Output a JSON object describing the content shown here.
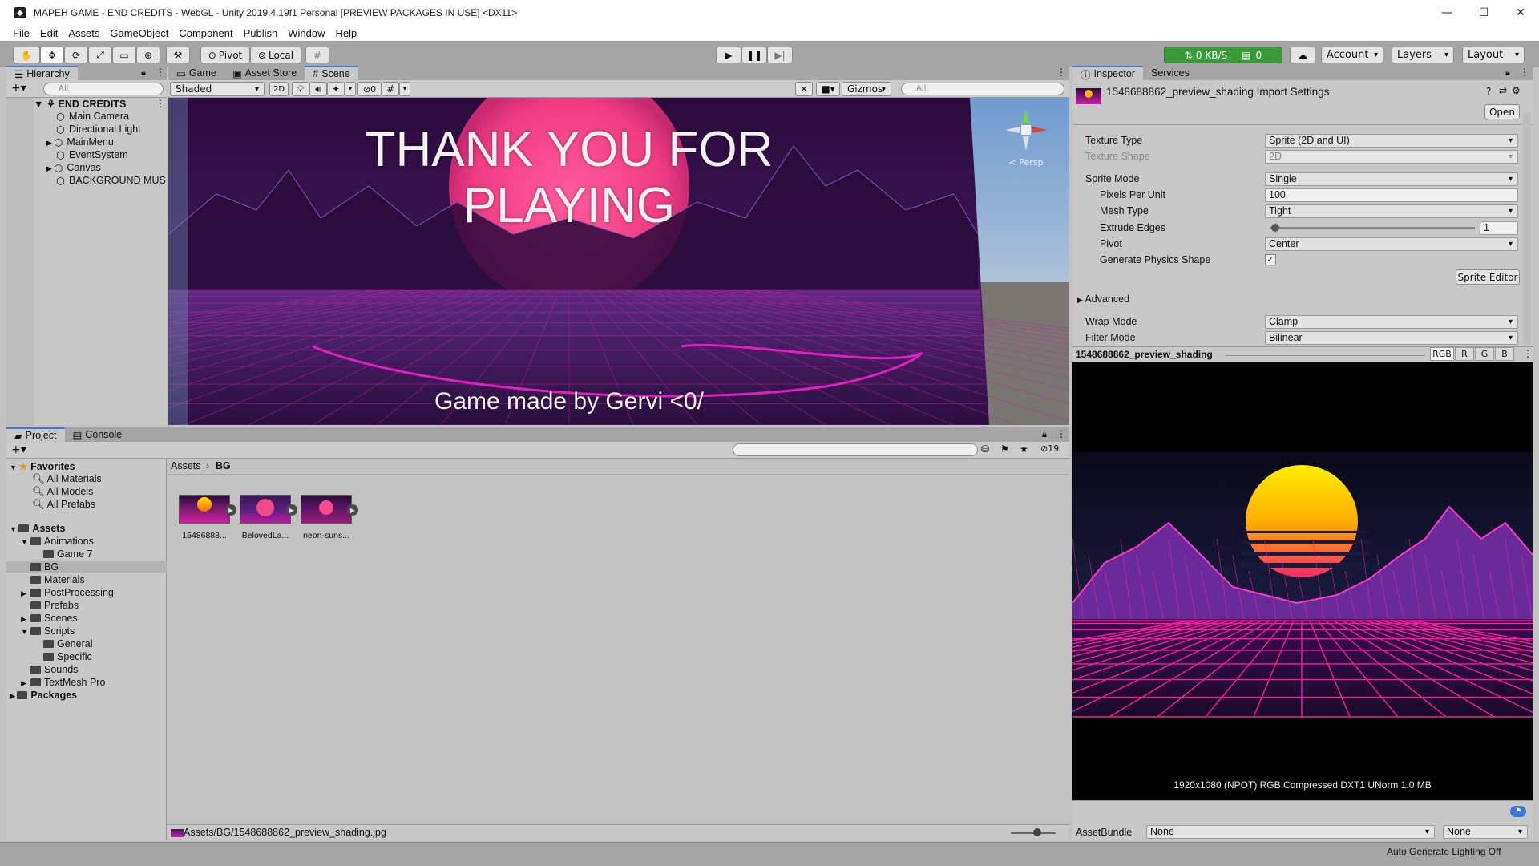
{
  "window": {
    "title": "MAPEH GAME - END CREDITS - WebGL - Unity 2019.4.19f1 Personal [PREVIEW PACKAGES IN USE] <DX11>",
    "minimize": "—",
    "maximize": "☐",
    "close": "✕"
  },
  "menu": [
    "File",
    "Edit",
    "Assets",
    "GameObject",
    "Component",
    "Publish",
    "Window",
    "Help"
  ],
  "toolbar": {
    "pivot": "Pivot",
    "local": "Local",
    "network": "0 KB/S",
    "files": "0",
    "account": "Account",
    "layers": "Layers",
    "layout": "Layout"
  },
  "hierarchy": {
    "tab": "Hierarchy",
    "search_placeholder": "All",
    "scene": "END CREDITS",
    "items": [
      "Main Camera",
      "Directional Light",
      "MainMenu",
      "EventSystem",
      "Canvas",
      "BACKGROUND MUSI"
    ]
  },
  "scene_tabs": [
    "Game",
    "Asset Store",
    "Scene"
  ],
  "scene_bar": {
    "shading": "Shaded",
    "mode2d": "2D",
    "hidden_count": "0",
    "gizmos": "Gizmos",
    "search_placeholder": "All"
  },
  "scene_view": {
    "title_line1": "THANK YOU FOR",
    "title_line2": "PLAYING",
    "credit": "Game made by Gervi <0/",
    "persp": "< Persp",
    "axis_y": "y"
  },
  "project": {
    "tabs": [
      "Project",
      "Console"
    ],
    "hidden_count": "19",
    "favorites_label": "Favorites",
    "favorites": [
      "All Materials",
      "All Models",
      "All Prefabs"
    ],
    "assets_label": "Assets",
    "tree": [
      {
        "label": "Animations",
        "depth": 1,
        "arrow": "open"
      },
      {
        "label": "Game 7",
        "depth": 2,
        "arrow": ""
      },
      {
        "label": "BG",
        "depth": 1,
        "arrow": "",
        "selected": true
      },
      {
        "label": "Materials",
        "depth": 1,
        "arrow": ""
      },
      {
        "label": "PostProcessing",
        "depth": 1,
        "arrow": "closed"
      },
      {
        "label": "Prefabs",
        "depth": 1,
        "arrow": ""
      },
      {
        "label": "Scenes",
        "depth": 1,
        "arrow": "closed"
      },
      {
        "label": "Scripts",
        "depth": 1,
        "arrow": "open"
      },
      {
        "label": "General",
        "depth": 2,
        "arrow": ""
      },
      {
        "label": "Specific",
        "depth": 2,
        "arrow": ""
      },
      {
        "label": "Sounds",
        "depth": 1,
        "arrow": ""
      },
      {
        "label": "TextMesh Pro",
        "depth": 1,
        "arrow": "closed"
      }
    ],
    "packages_label": "Packages",
    "breadcrumb_root": "Assets",
    "breadcrumb_current": "BG",
    "assets": [
      "15486888...",
      "BelovedLa...",
      "neon-suns..."
    ],
    "status_path": "Assets/BG/1548688862_preview_shading.jpg"
  },
  "inspector": {
    "tabs": [
      "Inspector",
      "Services"
    ],
    "title": "1548688862_preview_shading Import Settings",
    "open": "Open",
    "fields": {
      "texture_type_label": "Texture Type",
      "texture_type": "Sprite (2D and UI)",
      "texture_shape_label": "Texture Shape",
      "texture_shape": "2D",
      "sprite_mode_label": "Sprite Mode",
      "sprite_mode": "Single",
      "ppu_label": "Pixels Per Unit",
      "ppu": "100",
      "mesh_type_label": "Mesh Type",
      "mesh_type": "Tight",
      "extrude_label": "Extrude Edges",
      "extrude": "1",
      "pivot_label": "Pivot",
      "pivot": "Center",
      "physics_label": "Generate Physics Shape",
      "physics_checked": "✓",
      "sprite_editor": "Sprite Editor",
      "advanced": "Advanced",
      "wrap_label": "Wrap Mode",
      "wrap": "Clamp",
      "filter_label": "Filter Mode",
      "filter": "Bilinear"
    },
    "preview_name": "1548688862_preview_shading",
    "channels": [
      "RGB",
      "R",
      "G",
      "B"
    ],
    "preview_info": "1920x1080 (NPOT)  RGB Compressed DXT1 UNorm   1.0 MB",
    "assetbundle_label": "AssetBundle",
    "assetbundle": "None",
    "assetbundle_variant": "None"
  },
  "status": {
    "lighting": "Auto Generate Lighting Off"
  },
  "colors": {
    "accent": "#3a79d8",
    "panel": "#c2c2c2",
    "toolbar": "#a5a5a5",
    "sun": "#f14a87",
    "grid": "#d01ea8"
  }
}
